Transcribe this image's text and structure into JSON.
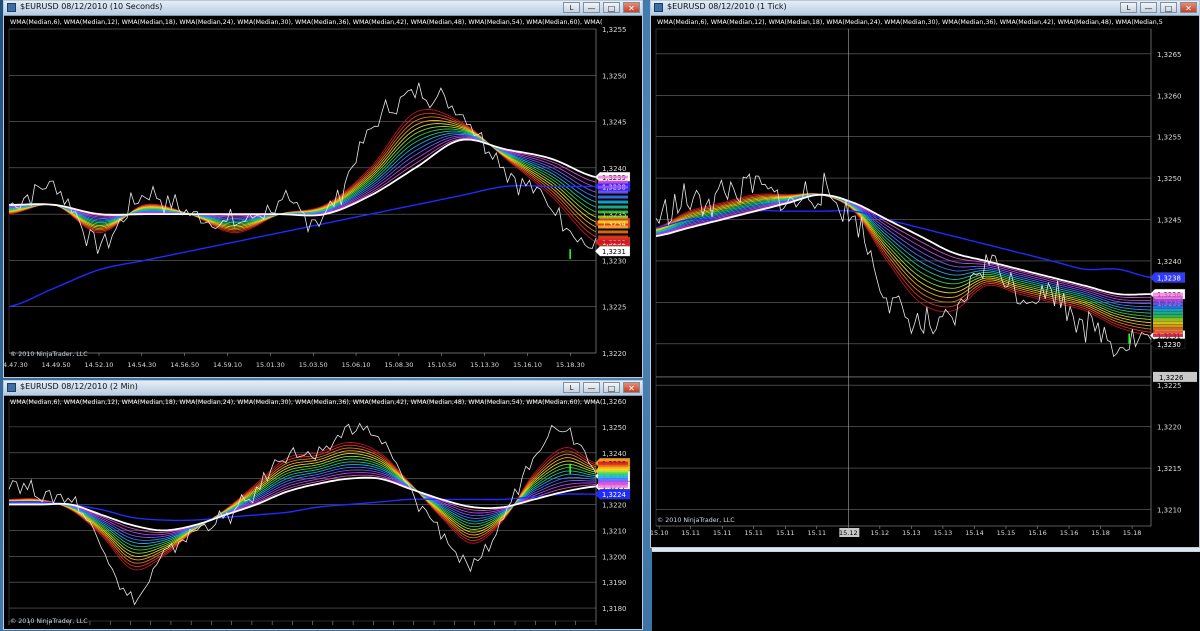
{
  "app": "NinjaTrader",
  "windows": [
    {
      "id": "w1",
      "title": "$EURUSD  08/12/2010 (10 Seconds)",
      "indicators": "WMA(Median,6), WMA(Median,12), WMA(Median,18), WMA(Median,24), WMA(Median,30), WMA(Median,36), WMA(Median,42), WMA(Median,48), WMA(Median,54), WMA(Median,60), WMA(",
      "copyright": "© 2010 NinjaTrader, LLC",
      "axis": {
        "min": 1.322,
        "max": 1.3255,
        "ticks": [
          "1,3255",
          "1,3250",
          "1,3245",
          "1,3240",
          "1,3235",
          "1,3230",
          "1,3225",
          "1,3220"
        ]
      },
      "time_labels": [
        "14.47.30",
        "14.49.50",
        "14.52.10",
        "14.54.30",
        "14.56.50",
        "14.59.10",
        "15.01.30",
        "15.03.50",
        "15.06.10",
        "15.08.30",
        "15.10.50",
        "15.13.30",
        "15.16.10",
        "15.18.30"
      ],
      "price_tags": [
        {
          "value": "1,3239",
          "color": "#ffffff",
          "text": "#000000"
        },
        {
          "value": "1,3238",
          "color": "#1f2bff",
          "text": "#ffffff"
        },
        {
          "value": "1,3234",
          "color": "#e03a20",
          "text": "#ffffff"
        },
        {
          "value": "1,3232",
          "color": "#d42a1a",
          "text": "#ffffff"
        },
        {
          "value": "1,3231",
          "color": "#ffffff",
          "text": "#000000"
        }
      ],
      "buttons": {
        "left": "L",
        "min": "—",
        "max": "□",
        "close": "✕"
      }
    },
    {
      "id": "w2",
      "title": "$EURUSD  08/12/2010 (2 Min)",
      "indicators": "WMA(Median,6), WMA(Median,12), WMA(Median,18), WMA(Median,24), WMA(Median,30), WMA(Median,36), WMA(Median,42), WMA(Median,48), WMA(Median,54), WMA(Median,60), WMA(",
      "copyright": "© 2010 NinjaTrader, LLC",
      "axis": {
        "min": 1.3175,
        "max": 1.326,
        "ticks": [
          "1,3260",
          "1,3250",
          "1,3240",
          "1,3230",
          "1,3220",
          "1,3210",
          "1,3200",
          "1,3190",
          "1,3180"
        ]
      },
      "price_tags": [
        {
          "value": "1,3236",
          "color": "#f39a1c",
          "text": "#000000"
        },
        {
          "value": "1,3233",
          "color": "#f3c21c",
          "text": "#000000"
        },
        {
          "value": "1,3231",
          "color": "#ffffff",
          "text": "#000000"
        },
        {
          "value": "1,3227",
          "color": "#ffffff",
          "text": "#000000"
        },
        {
          "value": "1,3224",
          "color": "#1f2bff",
          "text": "#ffffff"
        }
      ],
      "buttons": {
        "left": "L",
        "min": "—",
        "max": "□",
        "close": "✕"
      }
    },
    {
      "id": "w3",
      "title": "$EURUSD  08/12/2010 (1 Tick)",
      "indicators": "WMA(Median,6), WMA(Median,12), WMA(Median,18), WMA(Median,24), WMA(Median,30), WMA(Median,36), WMA(Median,42), WMA(Median,48), WMA(Median,5",
      "copyright": "© 2010 NinjaTrader, LLC",
      "axis": {
        "min": 1.3208,
        "max": 1.3268,
        "ticks": [
          "1,3265",
          "1,3260",
          "1,3255",
          "1,3250",
          "1,3245",
          "1,3240",
          "1,3235",
          "1,3230",
          "1,3225",
          "1,3220",
          "1,3215",
          "1,3210"
        ]
      },
      "time_labels": [
        "15.10",
        "15.11",
        "15.11",
        "15.11",
        "15.11",
        "15.11",
        "15.12",
        "15.12",
        "15.13",
        "15.13",
        "15.14",
        "15.15",
        "15.16",
        "15.16",
        "15.18",
        "15.18"
      ],
      "crosshair_time": "15.12",
      "crosshair_price": "1,3226",
      "price_tags": [
        {
          "value": "1,3238",
          "color": "#2f3aff",
          "text": "#ffffff"
        },
        {
          "value": "1,3236",
          "color": "#ffffff",
          "text": "#000000"
        },
        {
          "value": "1,3231",
          "color": "#ffffff",
          "text": "#000000"
        },
        {
          "value": "1,3230",
          "color": "#000000",
          "text": "#ffffff"
        }
      ],
      "buttons": {
        "left": "L",
        "min": "—",
        "max": "□",
        "close": "✕"
      }
    }
  ],
  "chart_data": [
    {
      "type": "line",
      "window": "$EURUSD 08/12/2010 (10 Seconds)",
      "ylim": [
        1.322,
        1.3255
      ],
      "categories": [
        "14.47.30",
        "14.49.50",
        "14.52.10",
        "14.54.30",
        "14.56.50",
        "14.59.10",
        "15.01.30",
        "15.03.50",
        "15.06.10",
        "15.08.30",
        "15.10.50",
        "15.13.30",
        "15.16.10",
        "15.18.30"
      ],
      "price": [
        1.3236,
        1.3238,
        1.3232,
        1.3237,
        1.3235,
        1.3234,
        1.3236,
        1.3235,
        1.3244,
        1.3248,
        1.3246,
        1.324,
        1.3236,
        1.3231
      ],
      "fast_ma": [
        1.3235,
        1.3236,
        1.3233,
        1.3236,
        1.3235,
        1.3233,
        1.3235,
        1.3236,
        1.324,
        1.3246,
        1.3245,
        1.3241,
        1.3237,
        1.3232
      ],
      "slow_ma": [
        1.3236,
        1.3236,
        1.3235,
        1.3235,
        1.3235,
        1.3235,
        1.3235,
        1.3235,
        1.3237,
        1.324,
        1.3243,
        1.3242,
        1.3241,
        1.3239
      ],
      "long_ma": [
        1.3225,
        1.3227,
        1.3229,
        1.323,
        1.3231,
        1.3232,
        1.3233,
        1.3234,
        1.3235,
        1.3236,
        1.3237,
        1.3238,
        1.3238,
        1.3238
      ]
    },
    {
      "type": "line",
      "window": "$EURUSD 08/12/2010 (2 Min)",
      "ylim": [
        1.3175,
        1.326
      ],
      "price": [
        1.323,
        1.3224,
        1.3222,
        1.3205,
        1.3183,
        1.32,
        1.321,
        1.3215,
        1.3225,
        1.324,
        1.3238,
        1.325,
        1.3245,
        1.3225,
        1.321,
        1.3195,
        1.3215,
        1.324,
        1.325,
        1.3235
      ],
      "fast_ma": [
        1.3222,
        1.3222,
        1.3218,
        1.3208,
        1.3195,
        1.32,
        1.321,
        1.3218,
        1.3228,
        1.3238,
        1.324,
        1.3244,
        1.324,
        1.3228,
        1.3215,
        1.3205,
        1.3214,
        1.3232,
        1.3242,
        1.3236
      ],
      "slow_ma": [
        1.322,
        1.322,
        1.322,
        1.3216,
        1.3212,
        1.321,
        1.3212,
        1.3216,
        1.322,
        1.3225,
        1.3228,
        1.323,
        1.323,
        1.3226,
        1.3222,
        1.3219,
        1.3219,
        1.3222,
        1.3225,
        1.3227
      ],
      "long_ma": [
        1.3221,
        1.3221,
        1.322,
        1.3218,
        1.3215,
        1.3214,
        1.3214,
        1.3215,
        1.3216,
        1.3217,
        1.3219,
        1.322,
        1.3221,
        1.3222,
        1.3222,
        1.3222,
        1.3222,
        1.3223,
        1.3224,
        1.3224
      ]
    },
    {
      "type": "line",
      "window": "$EURUSD 08/12/2010 (1 Tick)",
      "ylim": [
        1.3208,
        1.3268
      ],
      "categories": [
        "15.10",
        "15.11",
        "15.11",
        "15.11",
        "15.11",
        "15.11",
        "15.12",
        "15.12",
        "15.13",
        "15.13",
        "15.14",
        "15.15",
        "15.16",
        "15.16",
        "15.18",
        "15.18"
      ],
      "price": [
        1.3245,
        1.3247,
        1.3248,
        1.3249,
        1.3247,
        1.3248,
        1.3245,
        1.3236,
        1.3232,
        1.3233,
        1.324,
        1.3236,
        1.3236,
        1.3233,
        1.323,
        1.3231
      ],
      "fast_ma": [
        1.3244,
        1.3246,
        1.3247,
        1.3248,
        1.3248,
        1.3248,
        1.3246,
        1.324,
        1.3235,
        1.3234,
        1.3237,
        1.3236,
        1.3235,
        1.3234,
        1.3232,
        1.3231
      ],
      "slow_ma": [
        1.3243,
        1.3244,
        1.3245,
        1.3246,
        1.3247,
        1.3248,
        1.3247,
        1.3245,
        1.3243,
        1.3241,
        1.324,
        1.3239,
        1.3238,
        1.3237,
        1.3236,
        1.3236
      ],
      "long_ma": [
        1.3244,
        1.3245,
        1.3245,
        1.3246,
        1.3246,
        1.3246,
        1.3246,
        1.3245,
        1.3244,
        1.3243,
        1.3242,
        1.3241,
        1.324,
        1.3239,
        1.3239,
        1.3238
      ]
    }
  ]
}
